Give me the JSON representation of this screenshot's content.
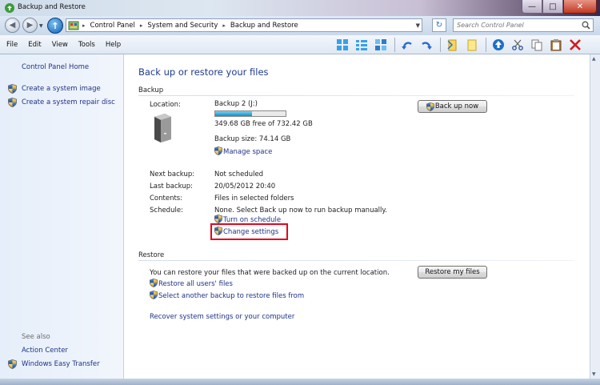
{
  "window": {
    "title": "Backup and Restore"
  },
  "address": {
    "crumbs": [
      "Control Panel",
      "System and Security",
      "Backup and Restore"
    ],
    "search_placeholder": "Search Control Panel"
  },
  "menu": [
    "File",
    "Edit",
    "View",
    "Tools",
    "Help"
  ],
  "toolbar_icons": [
    "view-large-icons",
    "view-details-icon",
    "view-tiles-icon",
    "undo-icon",
    "redo-icon",
    "favorites-icon",
    "folder-icon",
    "up-icon",
    "cut-icon",
    "copy-icon",
    "paste-icon",
    "delete-icon"
  ],
  "sidebar": {
    "home": "Control Panel Home",
    "tasks": [
      "Create a system image",
      "Create a system repair disc"
    ],
    "see_also_title": "See also",
    "see_also": [
      "Action Center",
      "Windows Easy Transfer"
    ]
  },
  "main": {
    "title": "Back up or restore your files",
    "backup": {
      "section": "Backup",
      "location_label": "Location:",
      "location_value": "Backup 2 (J:)",
      "free_space": "349.68 GB free of 732.42 GB",
      "used_fraction": 0.523,
      "backup_size": "Backup size: 74.14 GB",
      "manage_space": "Manage space",
      "backup_now": "Back up now",
      "next_backup_label": "Next backup:",
      "next_backup_value": "Not scheduled",
      "last_backup_label": "Last backup:",
      "last_backup_value": "20/05/2012 20:40",
      "contents_label": "Contents:",
      "contents_value": "Files in selected folders",
      "schedule_label": "Schedule:",
      "schedule_value": "None. Select Back up now to run backup manually.",
      "turn_on_schedule": "Turn on schedule",
      "change_settings": "Change settings"
    },
    "restore": {
      "section": "Restore",
      "description": "You can restore your files that were backed up on the current location.",
      "restore_my_files": "Restore my files",
      "restore_all_users": "Restore all users' files",
      "select_another": "Select another backup to restore files from",
      "recover_system": "Recover system settings or your computer"
    }
  },
  "colors": {
    "link": "#1e3287",
    "heading": "#1e3b8c",
    "highlight_box": "#e3061c"
  }
}
